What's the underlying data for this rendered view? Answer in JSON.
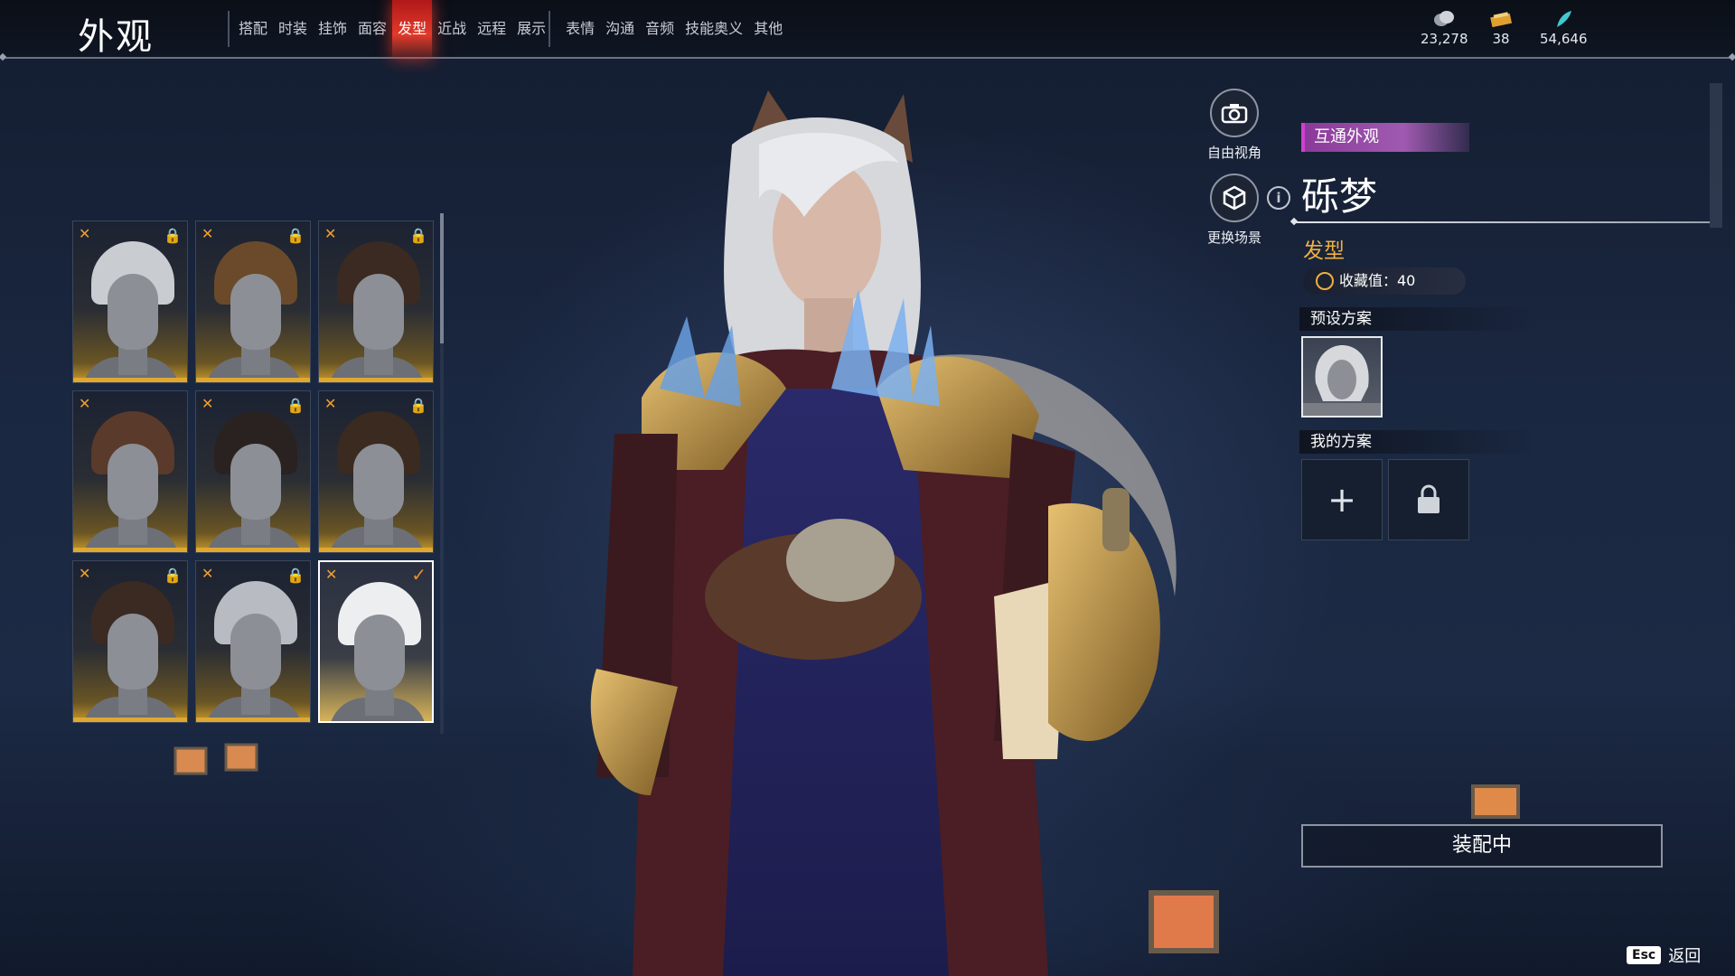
{
  "header": {
    "title": "外观",
    "tabs": [
      {
        "label": "搭配",
        "active": false
      },
      {
        "label": "时装",
        "active": false
      },
      {
        "label": "挂饰",
        "active": false
      },
      {
        "label": "面容",
        "active": false
      },
      {
        "label": "发型",
        "active": true
      },
      {
        "label": "近战",
        "active": false
      },
      {
        "label": "远程",
        "active": false
      },
      {
        "label": "展示",
        "active": false
      },
      {
        "label": "表情",
        "active": false
      },
      {
        "label": "沟通",
        "active": false
      },
      {
        "label": "音频",
        "active": false
      },
      {
        "label": "技能奥义",
        "active": false
      },
      {
        "label": "其他",
        "active": false
      }
    ],
    "currencies": [
      {
        "icon": "coin-stack-icon",
        "value": "23,278"
      },
      {
        "icon": "ticket-icon",
        "value": "38"
      },
      {
        "icon": "feather-icon",
        "value": "54,646"
      }
    ]
  },
  "hair_grid": [
    {
      "hair_color": "#c9ccd0",
      "locked": true,
      "selected": false
    },
    {
      "hair_color": "#6a4a2a",
      "locked": true,
      "selected": false
    },
    {
      "hair_color": "#3a2a22",
      "locked": true,
      "selected": false
    },
    {
      "hair_color": "#5a3a2a",
      "locked": false,
      "selected": false
    },
    {
      "hair_color": "#2a2220",
      "locked": true,
      "selected": false
    },
    {
      "hair_color": "#3a2a20",
      "locked": true,
      "selected": false
    },
    {
      "hair_color": "#3a2a22",
      "locked": true,
      "selected": false
    },
    {
      "hair_color": "#b8bcc2",
      "locked": true,
      "selected": false
    },
    {
      "hair_color": "#eceef0",
      "locked": false,
      "selected": true
    }
  ],
  "side_buttons": {
    "free_view": "自由视角",
    "change_scene": "更换场景"
  },
  "panel": {
    "badge": "互通外观",
    "item_name": "砾梦",
    "item_type": "发型",
    "collection": "收藏值：40",
    "preset_header": "预设方案",
    "my_plan_header": "我的方案",
    "add_symbol": "+",
    "equip_label": "装配中"
  },
  "footer": {
    "esc_key": "Esc",
    "back_label": "返回"
  },
  "colors": {
    "accent_red": "#e33a2a",
    "gold": "#f0b040",
    "badge_purple": "#a05ab0"
  }
}
